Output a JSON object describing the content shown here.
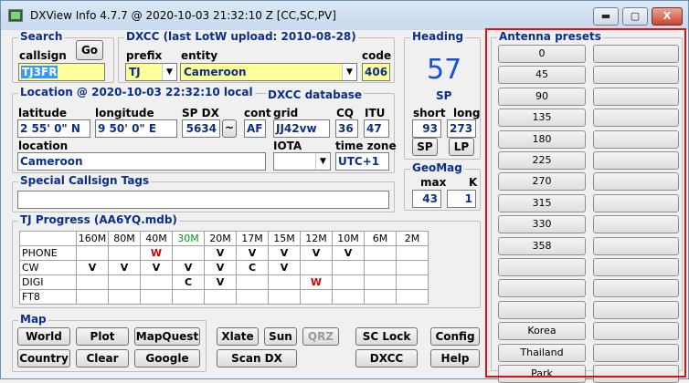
{
  "window": {
    "title": "DXView Info 4.7.7 @ 2020-10-03  21:32:10 Z  [CC,SC,PV]",
    "min": "▬",
    "max": "▢",
    "close": "X"
  },
  "search": {
    "title": "Search",
    "callsign_label": "callsign",
    "callsign": "TJ3FR",
    "go": "Go"
  },
  "dxcc": {
    "title": "DXCC  (last LotW upload: 2010-08-28)",
    "prefix_label": "prefix",
    "prefix": "TJ",
    "entity_label": "entity",
    "entity": "Cameroon",
    "code_label": "code",
    "code": "406"
  },
  "location": {
    "title": "Location @ 2020-10-03 22:32:10 local",
    "db_label": "DXCC database",
    "lat_label": "latitude",
    "lat": "2 55' 0\" N",
    "long_label": "longitude",
    "long": "9 50' 0\" E",
    "spdx_label": "SP DX",
    "spdx": "5634",
    "tilde": "~",
    "cont_label": "cont",
    "cont": "AF",
    "grid_label": "grid",
    "grid": "JJ42vw",
    "cq_label": "CQ",
    "cq": "36",
    "itu_label": "ITU",
    "itu": "47",
    "loc_label": "location",
    "loc": "Cameroon",
    "iota_label": "IOTA",
    "iota": "",
    "tz_label": "time zone",
    "tz": "UTC+1"
  },
  "heading": {
    "title": "Heading",
    "value": "57",
    "sp": "SP",
    "short_label": "short",
    "short": "93",
    "long_label": "long",
    "long": "273",
    "sp_btn": "SP",
    "lp_btn": "LP"
  },
  "geomag": {
    "title": "GeoMag",
    "max_label": "max",
    "max": "43",
    "k_label": "K",
    "k": "1"
  },
  "tags": {
    "title": "Special Callsign Tags",
    "value": ""
  },
  "progress": {
    "title": "TJ Progress (AA6YQ.mdb)",
    "bands": [
      "160M",
      "80M",
      "40M",
      "30M",
      "20M",
      "17M",
      "15M",
      "12M",
      "10M",
      "6M",
      "2M"
    ],
    "rows": [
      {
        "mode": "PHONE",
        "cells": [
          "",
          "",
          "W",
          "",
          "V",
          "V",
          "V",
          "V",
          "V",
          "",
          ""
        ]
      },
      {
        "mode": "CW",
        "cells": [
          "V",
          "V",
          "V",
          "V",
          "V",
          "C",
          "V",
          "",
          "",
          "",
          ""
        ]
      },
      {
        "mode": "DIGI",
        "cells": [
          "",
          "",
          "",
          "C",
          "V",
          "",
          "",
          "W",
          "",
          "",
          ""
        ]
      },
      {
        "mode": "FT8",
        "cells": [
          "",
          "",
          "",
          "",
          "",
          "",
          "",
          "",
          "",
          "",
          ""
        ]
      }
    ]
  },
  "map": {
    "title": "Map",
    "world": "World",
    "plot": "Plot",
    "mapquest": "MapQuest",
    "country": "Country",
    "clear": "Clear",
    "google": "Google"
  },
  "tools": {
    "xlate": "Xlate",
    "sun": "Sun",
    "qrz": "QRZ",
    "sclock": "SC Lock",
    "config": "Config",
    "scandx": "Scan DX",
    "dxcc": "DXCC",
    "help": "Help"
  },
  "antenna": {
    "title": "Antenna presets",
    "left": [
      "0",
      "45",
      "90",
      "135",
      "180",
      "225",
      "270",
      "315",
      "330",
      "358",
      "",
      "",
      "",
      "Korea",
      "Thailand",
      "Park"
    ],
    "right": [
      "",
      "",
      "",
      "",
      "",
      "",
      "",
      "",
      "",
      "",
      "",
      "",
      "",
      "",
      "",
      ""
    ]
  }
}
